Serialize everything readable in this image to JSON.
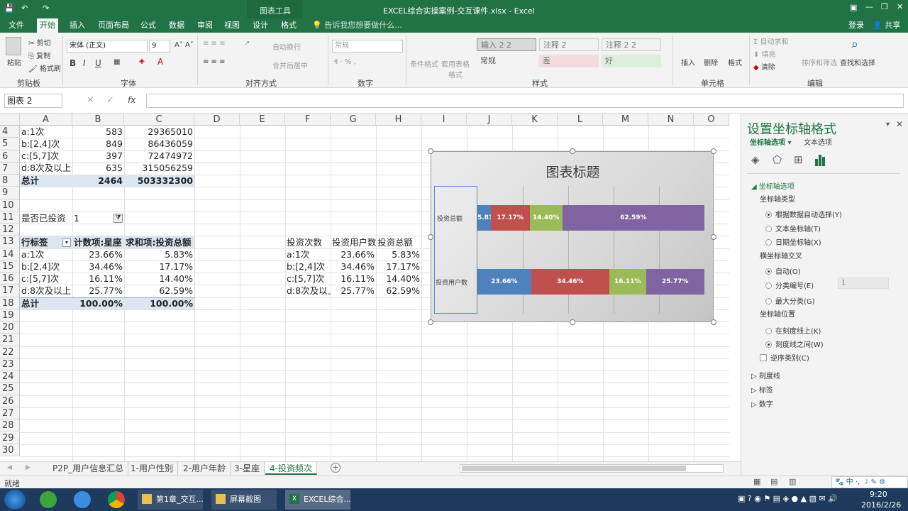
{
  "window": {
    "title": "EXCEL综合实操案例-交互课件.xlsx - Excel",
    "context_tools": "图表工具"
  },
  "tabs": [
    "文件",
    "开始",
    "插入",
    "页面布局",
    "公式",
    "数据",
    "审阅",
    "视图",
    "设计",
    "格式"
  ],
  "tell_me": "告诉我您想要做什么...",
  "account": {
    "login": "登录",
    "share": "共享"
  },
  "ribbon": {
    "clipboard": {
      "paste": "粘贴",
      "cut": "剪切",
      "copy": "复制",
      "painter": "格式刷",
      "label": "剪贴板"
    },
    "font": {
      "name": "宋体 (正文)",
      "size": "9",
      "label": "字体"
    },
    "align": {
      "wrap": "自动换行",
      "merge": "合并后居中",
      "label": "对齐方式"
    },
    "number": {
      "format": "常规",
      "label": "数字"
    },
    "styles": {
      "cond": "条件格式",
      "table": "套用表格格式",
      "cells": [
        "输入 2 2",
        "注释 2",
        "注释 2 2",
        "常规",
        "差",
        "好"
      ],
      "label": "样式"
    },
    "cells": {
      "insert": "插入",
      "delete": "删除",
      "format": "格式",
      "label": "单元格"
    },
    "edit": {
      "autosum": "自动求和",
      "fill": "填充",
      "clear": "清除",
      "sort": "排序和筛选",
      "find": "查找和选择",
      "label": "编辑"
    }
  },
  "namebox": "图表 2",
  "fx": "fx",
  "columns": [
    "A",
    "B",
    "C",
    "D",
    "E",
    "F",
    "G",
    "H",
    "I",
    "J",
    "K",
    "L",
    "M",
    "N",
    "O"
  ],
  "rows": [
    "4",
    "5",
    "6",
    "7",
    "8",
    "9",
    "10",
    "11",
    "12",
    "13",
    "14",
    "15",
    "16",
    "17",
    "18",
    "19",
    "20",
    "21",
    "22",
    "23",
    "24",
    "25",
    "26",
    "27",
    "28",
    "29",
    "30"
  ],
  "table1": [
    {
      "a": "a:1次",
      "b": "583",
      "c": "29365010"
    },
    {
      "a": "b:[2,4]次",
      "b": "849",
      "c": "86436059"
    },
    {
      "a": "c:[5,7]次",
      "b": "397",
      "c": "72474972"
    },
    {
      "a": "d:8次及以上",
      "b": "635",
      "c": "315056259"
    },
    {
      "a": "总计",
      "b": "2464",
      "c": "503332300"
    }
  ],
  "filter": {
    "label": "是否已投资",
    "value": "1"
  },
  "pivot": {
    "headers": [
      "行标签",
      "计数项:星座",
      "求和项:投资总额"
    ],
    "rows": [
      {
        "a": "a:1次",
        "b": "23.66%",
        "c": "5.83%"
      },
      {
        "a": "b:[2,4]次",
        "b": "34.46%",
        "c": "17.17%"
      },
      {
        "a": "c:[5,7]次",
        "b": "16.11%",
        "c": "14.40%"
      },
      {
        "a": "d:8次及以上",
        "b": "25.77%",
        "c": "62.59%"
      },
      {
        "a": "总计",
        "b": "100.00%",
        "c": "100.00%"
      }
    ]
  },
  "table2": {
    "headers": [
      "投资次数",
      "投资用户数",
      "投资总额"
    ],
    "rows": [
      {
        "f": "a:1次",
        "g": "23.66%",
        "h": "5.83%"
      },
      {
        "f": "b:[2,4]次",
        "g": "34.46%",
        "h": "17.17%"
      },
      {
        "f": "c:[5,7]次",
        "g": "16.11%",
        "h": "14.40%"
      },
      {
        "f": "d:8次及以上",
        "g": "25.77%",
        "h": "62.59%"
      }
    ]
  },
  "chart_data": {
    "type": "bar",
    "stacked": "100%",
    "title": "图表标题",
    "categories": [
      "投资总额",
      "投资用户数"
    ],
    "series": [
      {
        "values": [
          5.83,
          23.66
        ],
        "color": "#4f81bd"
      },
      {
        "values": [
          17.17,
          34.46
        ],
        "color": "#c0504d"
      },
      {
        "values": [
          14.4,
          16.11
        ],
        "color": "#9bbb59"
      },
      {
        "values": [
          62.59,
          25.77
        ],
        "color": "#8064a2"
      }
    ],
    "labels": [
      [
        "5.83%",
        "17.17%",
        "14.40%",
        "62.59%"
      ],
      [
        "23.66%",
        "34.46%",
        "16.11%",
        "25.77%"
      ]
    ]
  },
  "panel": {
    "title": "设置坐标轴格式",
    "tab1": "坐标轴选项",
    "tab2": "文本选项",
    "section": "坐标轴选项",
    "axis_type": "坐标轴类型",
    "type_opts": [
      "根据数据自动选择(Y)",
      "文本坐标轴(T)",
      "日期坐标轴(X)"
    ],
    "cross": "横坐标轴交叉",
    "cross_opts": [
      "自动(O)",
      "分类编号(E)",
      "最大分类(G)"
    ],
    "cross_value": "1",
    "position": "坐标轴位置",
    "pos_opts": [
      "在刻度线上(K)",
      "刻度线之间(W)"
    ],
    "reverse": "逆序类别(C)",
    "collapsed": [
      "刻度线",
      "标签",
      "数字"
    ]
  },
  "sheet_tabs": [
    "P2P_用户信息汇总",
    "1-用户性别",
    "2-用户年龄",
    "3-星座",
    "4-投资频次"
  ],
  "status": "就绪",
  "taskbar": {
    "items": [
      "第1章_交互...",
      "屏幕截图",
      "EXCEL综合..."
    ],
    "time": "9:20",
    "date": "2016/2/26",
    "ime": "中"
  }
}
